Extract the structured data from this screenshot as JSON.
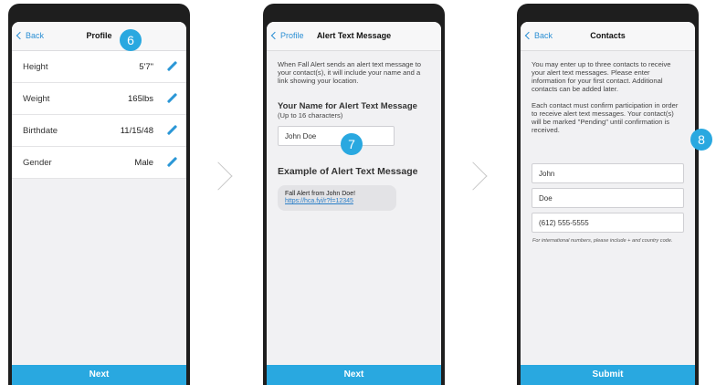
{
  "screen1": {
    "back_label": "Back",
    "title": "Profile",
    "rows": [
      {
        "label": "Height",
        "value": "5'7\""
      },
      {
        "label": "Weight",
        "value": "165lbs"
      },
      {
        "label": "Birthdate",
        "value": "11/15/48"
      },
      {
        "label": "Gender",
        "value": "Male"
      }
    ],
    "badge": "6",
    "button": "Next"
  },
  "screen2": {
    "back_label": "Profile",
    "title": "Alert Text Message",
    "intro": "When Fall Alert sends an alert text message to your contact(s), it will include your name and a link showing your location.",
    "name_heading": "Your Name for Alert Text Message",
    "name_sub": "(Up to 16 characters)",
    "name_value": "John Doe",
    "badge": "7",
    "example_heading": "Example of Alert Text Message",
    "example_line1": "Fall Alert from John Doe!",
    "example_link": "https://hca.fyi/r?f=12345",
    "button": "Next"
  },
  "screen3": {
    "back_label": "Back",
    "title": "Contacts",
    "para1": "You may enter up to three contacts to receive your alert text messages. Please enter information for your first contact. Additional contacts can be added later.",
    "para2": "Each contact must confirm participation in order to receive alert text messages. Your contact(s) will be marked \"Pending\" until confirmation is received.",
    "badge": "8",
    "first_name": "John",
    "last_name": "Doe",
    "phone": "(612) 555-5555",
    "note": "For international numbers, please include + and country code.",
    "button": "Submit"
  }
}
